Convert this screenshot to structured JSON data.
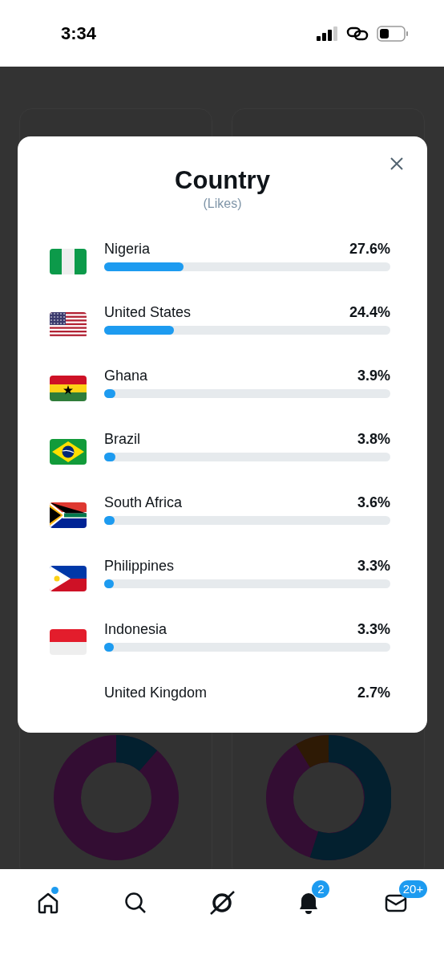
{
  "status_bar": {
    "time": "3:34"
  },
  "modal": {
    "title": "Country",
    "subtitle": "(Likes)",
    "rows": [
      {
        "kind": "nigeria",
        "name": "Nigeria",
        "value": "27.6%",
        "level": 0.276
      },
      {
        "kind": "usa",
        "name": "United States",
        "value": "24.4%",
        "level": 0.244
      },
      {
        "kind": "ghana",
        "name": "Ghana",
        "value": "3.9%",
        "level": 0.039
      },
      {
        "kind": "brazil",
        "name": "Brazil",
        "value": "3.8%",
        "level": 0.038
      },
      {
        "kind": "southafrica",
        "name": "South Africa",
        "value": "3.6%",
        "level": 0.036
      },
      {
        "kind": "philippines",
        "name": "Philippines",
        "value": "3.3%",
        "level": 0.033
      },
      {
        "kind": "indonesia",
        "name": "Indonesia",
        "value": "3.3%",
        "level": 0.033
      },
      {
        "name": "United Kingdom",
        "value": "2.7%"
      }
    ]
  },
  "tab_bar": {
    "items": [
      {
        "kind": "home",
        "dot": true
      },
      {
        "kind": "search"
      },
      {
        "kind": "grok"
      },
      {
        "kind": "bell",
        "badge": "2"
      },
      {
        "kind": "mail",
        "badge": "20+"
      }
    ]
  }
}
